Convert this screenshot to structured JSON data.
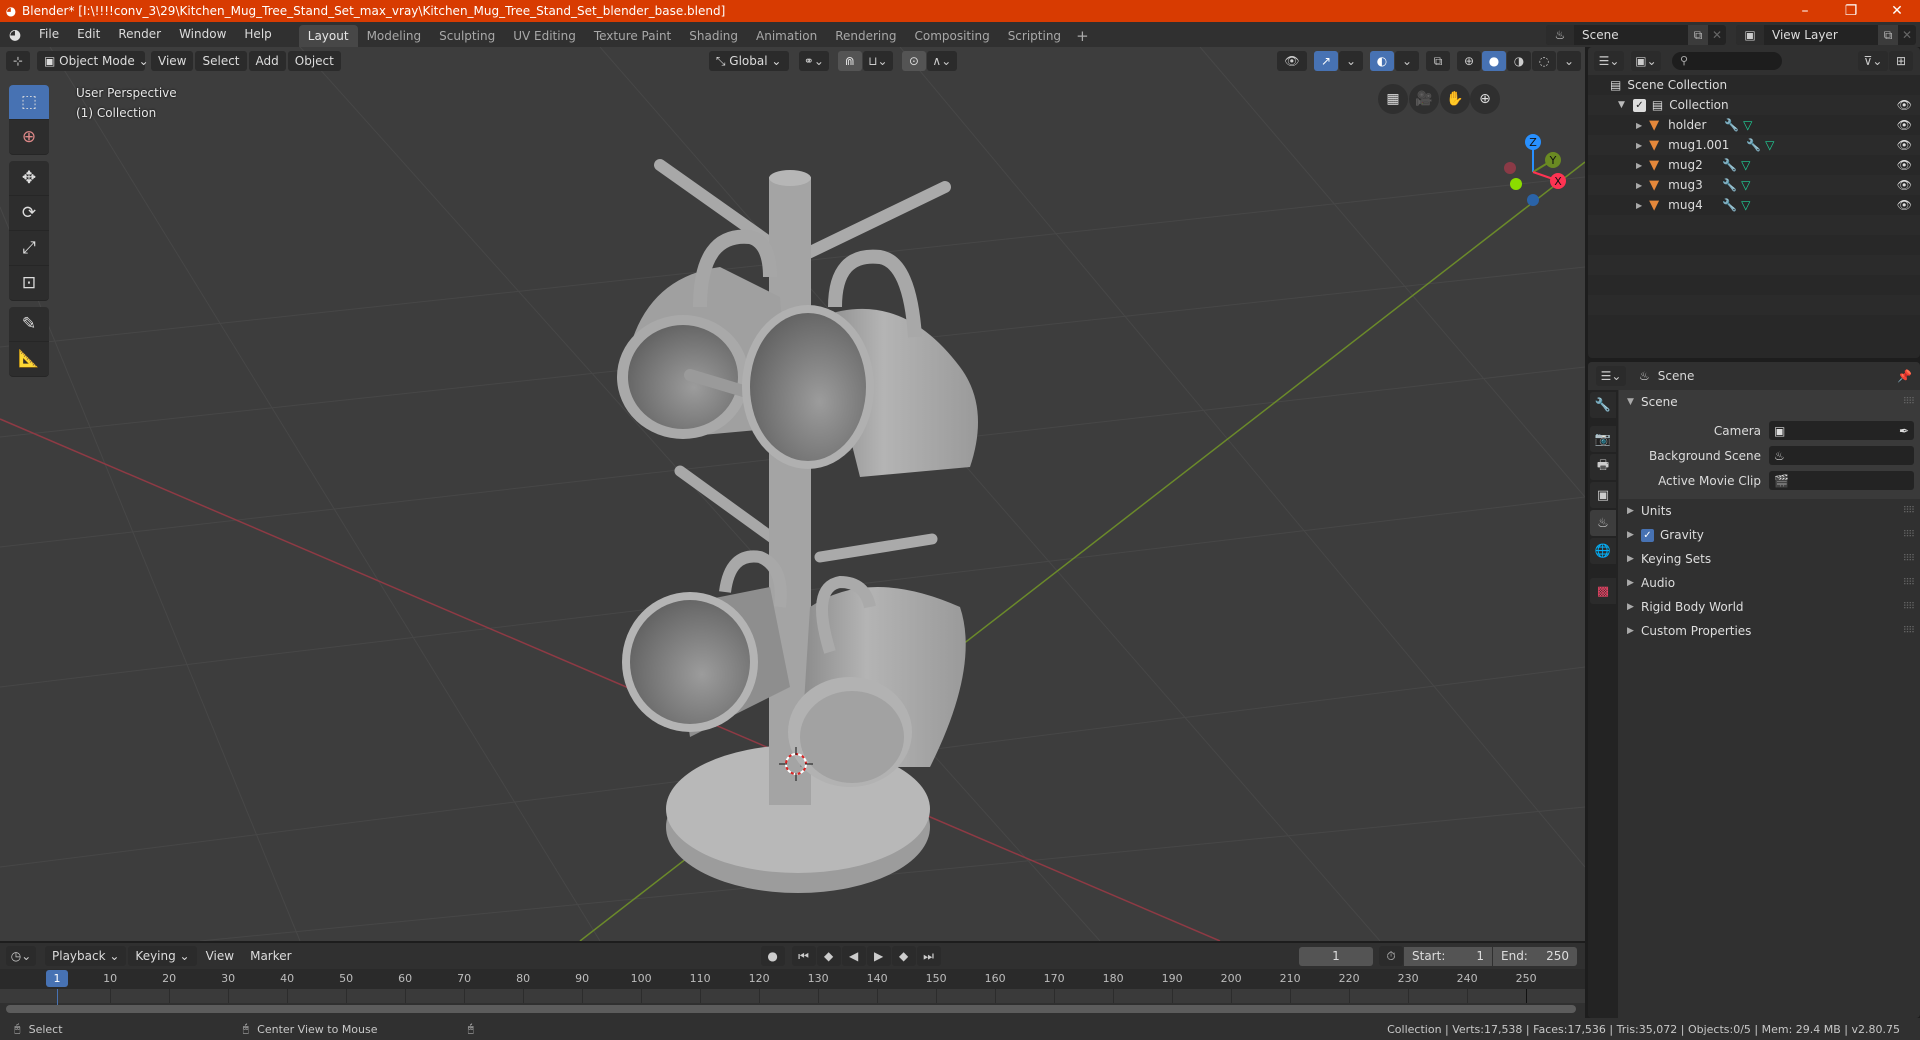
{
  "window": {
    "title": "Blender* [I:\\!!!!conv_3\\29\\Kitchen_Mug_Tree_Stand_Set_max_vray\\Kitchen_Mug_Tree_Stand_Set_blender_base.blend]",
    "controls": {
      "minimize": "–",
      "maximize": "❐",
      "close": "✕"
    },
    "title_bar_color": "#d83b01"
  },
  "menu": [
    "File",
    "Edit",
    "Render",
    "Window",
    "Help"
  ],
  "workspaces": {
    "tabs": [
      "Layout",
      "Modeling",
      "Sculpting",
      "UV Editing",
      "Texture Paint",
      "Shading",
      "Animation",
      "Rendering",
      "Compositing",
      "Scripting"
    ],
    "active": "Layout",
    "add_label": "+"
  },
  "scene_selector": {
    "value": "Scene"
  },
  "view_layer_selector": {
    "value": "View Layer"
  },
  "viewport_header": {
    "mode": "Object Mode",
    "menus": [
      "View",
      "Select",
      "Add",
      "Object"
    ],
    "transform_orientation": "Global"
  },
  "viewport": {
    "perspective_label": "User Perspective",
    "collection_label": "(1) Collection",
    "tools": [
      "select-box",
      "cursor",
      "move",
      "rotate",
      "scale",
      "transform",
      "annotate",
      "measure"
    ],
    "active_tool": "select-box",
    "nav_buttons": [
      "grid-icon",
      "camera-icon",
      "hand-icon",
      "zoom-icon"
    ],
    "gizmo": {
      "x": "X",
      "y": "Y",
      "z": "Z"
    },
    "colors": {
      "x_axis": "#ff3352",
      "y_axis": "#8bdc00",
      "z_axis": "#2890ff",
      "accent": "#4772b3"
    }
  },
  "outliner": {
    "root": "Scene Collection",
    "collection": "Collection",
    "objects": [
      {
        "name": "holder"
      },
      {
        "name": "mug1.001"
      },
      {
        "name": "mug2"
      },
      {
        "name": "mug3"
      },
      {
        "name": "mug4"
      }
    ]
  },
  "properties": {
    "context": "Scene",
    "scene_panel": {
      "title": "Scene",
      "fields": [
        {
          "label": "Camera",
          "value": ""
        },
        {
          "label": "Background Scene",
          "value": ""
        },
        {
          "label": "Active Movie Clip",
          "value": ""
        }
      ]
    },
    "collapsed_panels": [
      "Units",
      "Gravity",
      "Keying Sets",
      "Audio",
      "Rigid Body World",
      "Custom Properties"
    ],
    "gravity_checked": true
  },
  "timeline": {
    "menus": [
      "Playback",
      "Keying",
      "View",
      "Marker"
    ],
    "current_frame": "1",
    "start_label": "Start:",
    "start": "1",
    "end_label": "End:",
    "end": "250",
    "ruler_ticks": [
      "10",
      "20",
      "30",
      "40",
      "50",
      "60",
      "70",
      "80",
      "90",
      "100",
      "110",
      "120",
      "130",
      "140",
      "150",
      "160",
      "170",
      "180",
      "190",
      "200",
      "210",
      "220",
      "230",
      "240",
      "250"
    ],
    "cursor_label": "1"
  },
  "statusbar": {
    "left_hint": "Select",
    "middle_hint": "Center View to Mouse",
    "stats": "Collection | Verts:17,538 | Faces:17,536 | Tris:35,072 | Objects:0/5 | Mem: 29.4 MB | v2.80.75"
  }
}
